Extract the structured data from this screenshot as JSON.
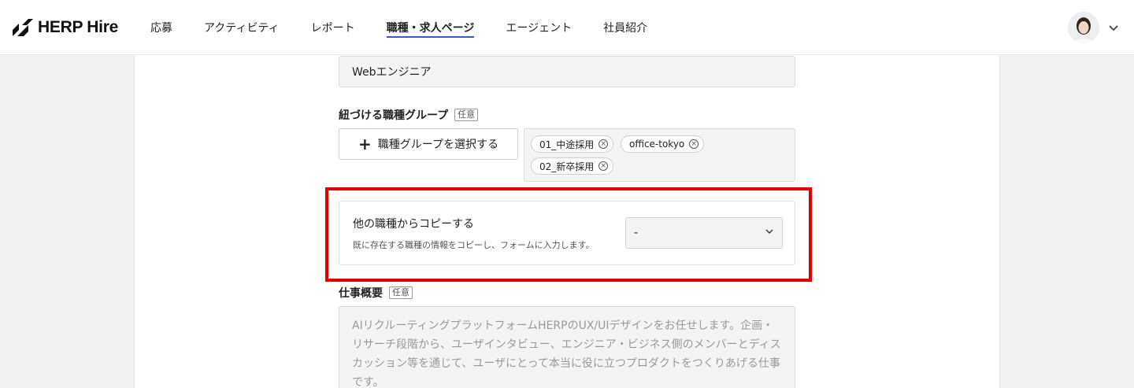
{
  "header": {
    "logo_text": "HERP Hire",
    "nav": [
      {
        "label": "応募",
        "active": false
      },
      {
        "label": "アクティビティ",
        "active": false
      },
      {
        "label": "レポート",
        "active": false
      },
      {
        "label": "職種・求人ページ",
        "active": true
      },
      {
        "label": "エージェント",
        "active": false
      },
      {
        "label": "社員紹介",
        "active": false
      }
    ],
    "accent_color": "#2f5fc4"
  },
  "form": {
    "job_title_value": "Webエンジニア",
    "group_label": "紐づける職種グループ",
    "optional_badge": "任意",
    "select_group_button": "職種グループを選択する",
    "tags": [
      "01_中途採用",
      "office-tokyo",
      "02_新卒採用"
    ],
    "copy": {
      "title": "他の職種からコピーする",
      "description": "既に存在する職種の情報をコピーし、フォームに入力します。",
      "select_value": "-"
    },
    "summary_label": "仕事概要",
    "summary_placeholder": "AIリクルーティングプラットフォームHERPのUX/UIデザインをお任せします。企画・リサーチ段階から、ユーザインタビュー、エンジニア・ビジネス側のメンバーとディスカッション等を通じて、ユーザにとって本当に役に立つプロダクトをつくりあげる仕事です。"
  },
  "highlight_color": "#e00000"
}
